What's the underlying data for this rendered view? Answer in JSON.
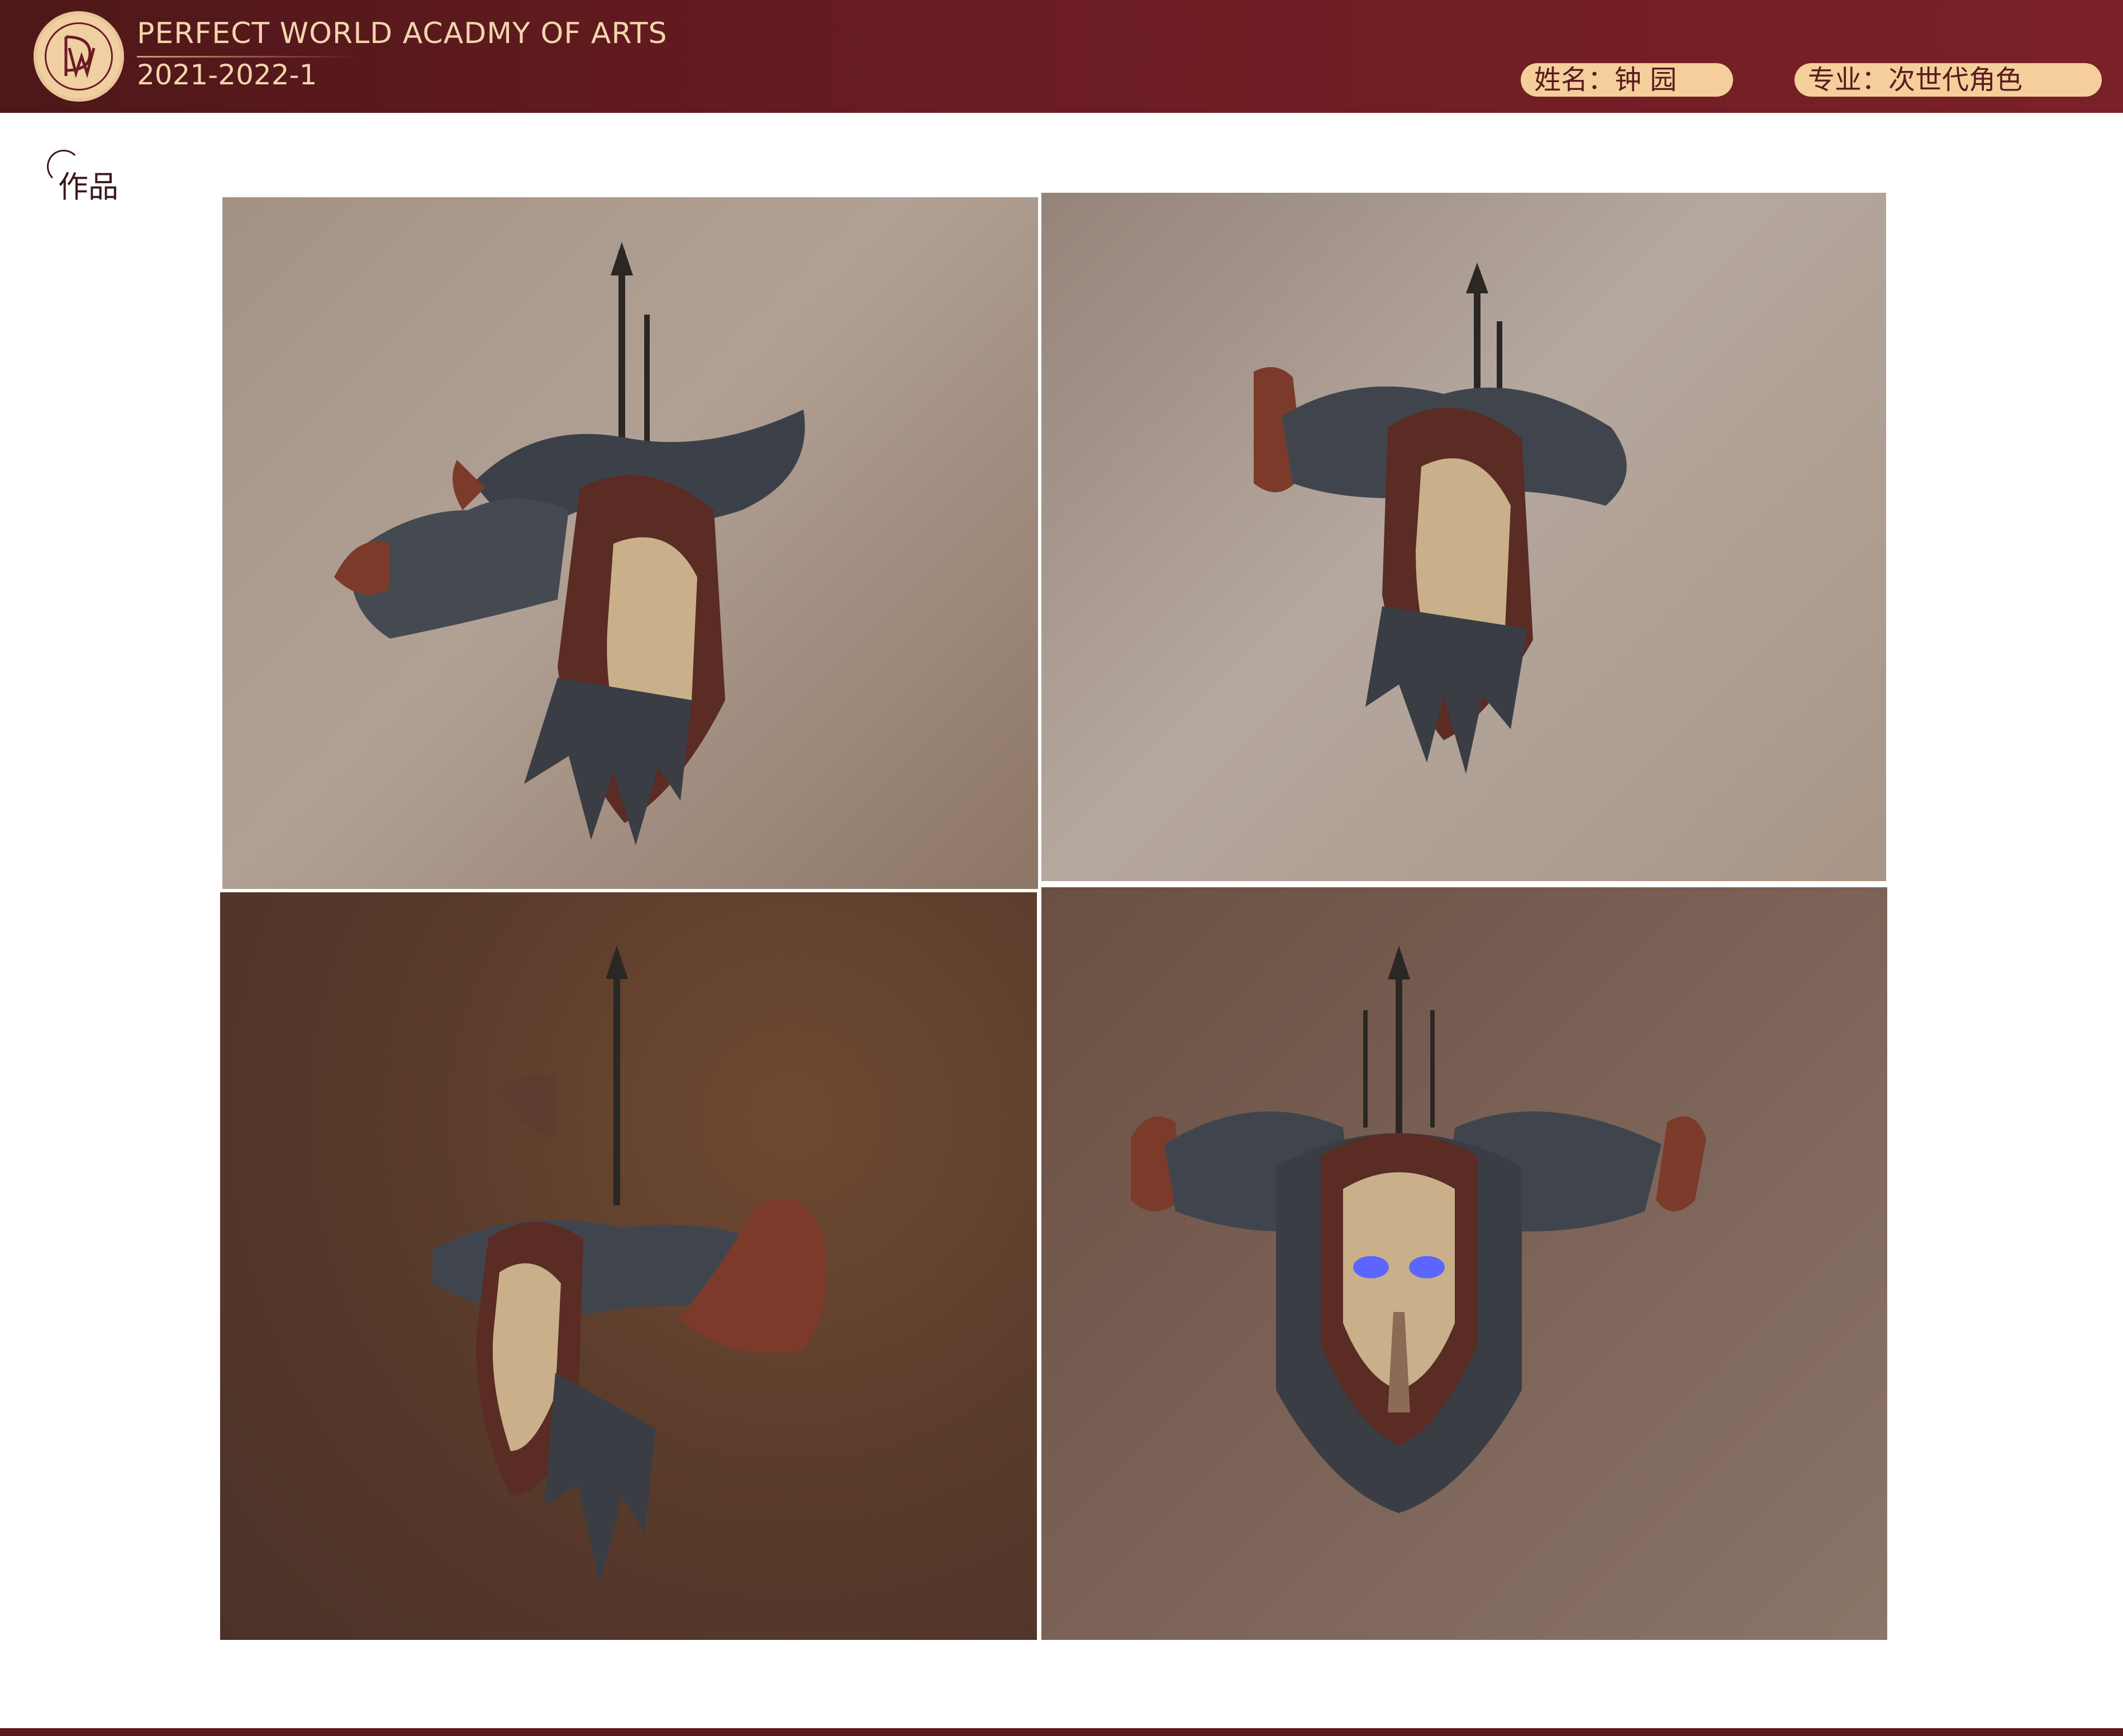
{
  "header": {
    "academy_title": "PERFECT WORLD ACADMY OF ARTS",
    "term": "2021-2022-1",
    "name_label": "姓名：钟 园",
    "major_label": "专业：次世代角色"
  },
  "section": {
    "label": "作品"
  },
  "gallery": {
    "panels": [
      {
        "view": "three-quarter-left",
        "image_icon": "horned-skull-shield-render"
      },
      {
        "view": "three-quarter-right",
        "image_icon": "horned-skull-shield-render"
      },
      {
        "view": "side-right",
        "image_icon": "horned-skull-shield-render"
      },
      {
        "view": "front",
        "image_icon": "horned-skull-shield-render"
      }
    ]
  },
  "colors": {
    "header": "#6a1c22",
    "accent": "#f4cf9b",
    "eye_glow": "#5a66ff"
  }
}
